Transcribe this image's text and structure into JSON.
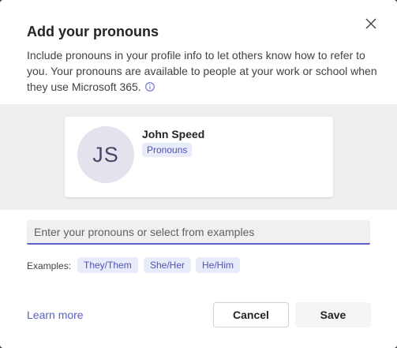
{
  "dialog": {
    "title": "Add your pronouns",
    "description": "Include pronouns in your profile info to let others know how to refer to you. Your pronouns are available to people at your work or school when they use Microsoft 365.",
    "close_icon": "close-icon",
    "info_icon": "info-icon"
  },
  "preview": {
    "initials": "JS",
    "name": "John Speed",
    "pronouns_badge": "Pronouns"
  },
  "input": {
    "value": "",
    "placeholder": "Enter your pronouns or select from examples"
  },
  "examples": {
    "label": "Examples:",
    "chips": [
      "They/Them",
      "She/Her",
      "He/Him"
    ]
  },
  "footer": {
    "learn_more": "Learn more",
    "cancel_label": "Cancel",
    "save_label": "Save"
  },
  "colors": {
    "accent": "#5b5fc7",
    "chip_bg": "#e8ebfa",
    "chip_text": "#4f52b2",
    "avatar_bg": "#e4e2ed"
  }
}
